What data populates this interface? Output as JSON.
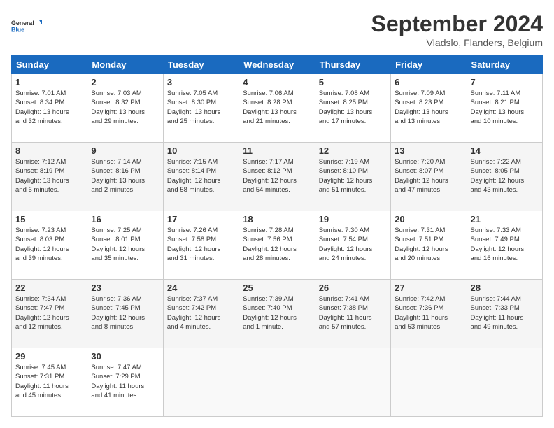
{
  "logo": {
    "general": "General",
    "blue": "Blue"
  },
  "title": "September 2024",
  "location": "Vladslo, Flanders, Belgium",
  "weekdays": [
    "Sunday",
    "Monday",
    "Tuesday",
    "Wednesday",
    "Thursday",
    "Friday",
    "Saturday"
  ],
  "weeks": [
    [
      {
        "day": "1",
        "info": "Sunrise: 7:01 AM\nSunset: 8:34 PM\nDaylight: 13 hours\nand 32 minutes."
      },
      {
        "day": "2",
        "info": "Sunrise: 7:03 AM\nSunset: 8:32 PM\nDaylight: 13 hours\nand 29 minutes."
      },
      {
        "day": "3",
        "info": "Sunrise: 7:05 AM\nSunset: 8:30 PM\nDaylight: 13 hours\nand 25 minutes."
      },
      {
        "day": "4",
        "info": "Sunrise: 7:06 AM\nSunset: 8:28 PM\nDaylight: 13 hours\nand 21 minutes."
      },
      {
        "day": "5",
        "info": "Sunrise: 7:08 AM\nSunset: 8:25 PM\nDaylight: 13 hours\nand 17 minutes."
      },
      {
        "day": "6",
        "info": "Sunrise: 7:09 AM\nSunset: 8:23 PM\nDaylight: 13 hours\nand 13 minutes."
      },
      {
        "day": "7",
        "info": "Sunrise: 7:11 AM\nSunset: 8:21 PM\nDaylight: 13 hours\nand 10 minutes."
      }
    ],
    [
      {
        "day": "8",
        "info": "Sunrise: 7:12 AM\nSunset: 8:19 PM\nDaylight: 13 hours\nand 6 minutes."
      },
      {
        "day": "9",
        "info": "Sunrise: 7:14 AM\nSunset: 8:16 PM\nDaylight: 13 hours\nand 2 minutes."
      },
      {
        "day": "10",
        "info": "Sunrise: 7:15 AM\nSunset: 8:14 PM\nDaylight: 12 hours\nand 58 minutes."
      },
      {
        "day": "11",
        "info": "Sunrise: 7:17 AM\nSunset: 8:12 PM\nDaylight: 12 hours\nand 54 minutes."
      },
      {
        "day": "12",
        "info": "Sunrise: 7:19 AM\nSunset: 8:10 PM\nDaylight: 12 hours\nand 51 minutes."
      },
      {
        "day": "13",
        "info": "Sunrise: 7:20 AM\nSunset: 8:07 PM\nDaylight: 12 hours\nand 47 minutes."
      },
      {
        "day": "14",
        "info": "Sunrise: 7:22 AM\nSunset: 8:05 PM\nDaylight: 12 hours\nand 43 minutes."
      }
    ],
    [
      {
        "day": "15",
        "info": "Sunrise: 7:23 AM\nSunset: 8:03 PM\nDaylight: 12 hours\nand 39 minutes."
      },
      {
        "day": "16",
        "info": "Sunrise: 7:25 AM\nSunset: 8:01 PM\nDaylight: 12 hours\nand 35 minutes."
      },
      {
        "day": "17",
        "info": "Sunrise: 7:26 AM\nSunset: 7:58 PM\nDaylight: 12 hours\nand 31 minutes."
      },
      {
        "day": "18",
        "info": "Sunrise: 7:28 AM\nSunset: 7:56 PM\nDaylight: 12 hours\nand 28 minutes."
      },
      {
        "day": "19",
        "info": "Sunrise: 7:30 AM\nSunset: 7:54 PM\nDaylight: 12 hours\nand 24 minutes."
      },
      {
        "day": "20",
        "info": "Sunrise: 7:31 AM\nSunset: 7:51 PM\nDaylight: 12 hours\nand 20 minutes."
      },
      {
        "day": "21",
        "info": "Sunrise: 7:33 AM\nSunset: 7:49 PM\nDaylight: 12 hours\nand 16 minutes."
      }
    ],
    [
      {
        "day": "22",
        "info": "Sunrise: 7:34 AM\nSunset: 7:47 PM\nDaylight: 12 hours\nand 12 minutes."
      },
      {
        "day": "23",
        "info": "Sunrise: 7:36 AM\nSunset: 7:45 PM\nDaylight: 12 hours\nand 8 minutes."
      },
      {
        "day": "24",
        "info": "Sunrise: 7:37 AM\nSunset: 7:42 PM\nDaylight: 12 hours\nand 4 minutes."
      },
      {
        "day": "25",
        "info": "Sunrise: 7:39 AM\nSunset: 7:40 PM\nDaylight: 12 hours\nand 1 minute."
      },
      {
        "day": "26",
        "info": "Sunrise: 7:41 AM\nSunset: 7:38 PM\nDaylight: 11 hours\nand 57 minutes."
      },
      {
        "day": "27",
        "info": "Sunrise: 7:42 AM\nSunset: 7:36 PM\nDaylight: 11 hours\nand 53 minutes."
      },
      {
        "day": "28",
        "info": "Sunrise: 7:44 AM\nSunset: 7:33 PM\nDaylight: 11 hours\nand 49 minutes."
      }
    ],
    [
      {
        "day": "29",
        "info": "Sunrise: 7:45 AM\nSunset: 7:31 PM\nDaylight: 11 hours\nand 45 minutes."
      },
      {
        "day": "30",
        "info": "Sunrise: 7:47 AM\nSunset: 7:29 PM\nDaylight: 11 hours\nand 41 minutes."
      },
      {
        "day": "",
        "info": ""
      },
      {
        "day": "",
        "info": ""
      },
      {
        "day": "",
        "info": ""
      },
      {
        "day": "",
        "info": ""
      },
      {
        "day": "",
        "info": ""
      }
    ]
  ]
}
